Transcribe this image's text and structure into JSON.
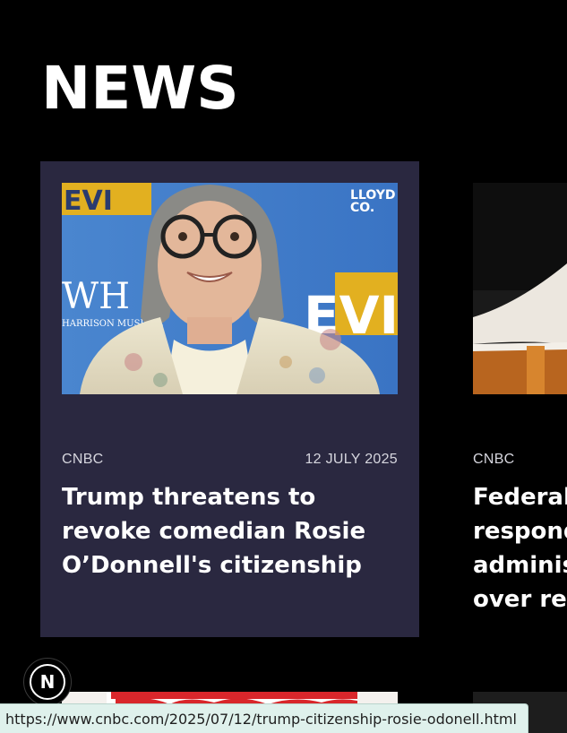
{
  "page": {
    "title": "NEWS"
  },
  "cards": [
    {
      "source": "CNBC",
      "date": "12 JULY 2025",
      "headline": "Trump threatens to revoke comedian Rosie O’Donnell's citizenship"
    },
    {
      "source": "CNBC",
      "headline_lines": [
        "Federal",
        "respond",
        "adminis",
        "over rem"
      ]
    }
  ],
  "framework_badge": {
    "letter": "N",
    "icon": "nextjs-logo-icon"
  },
  "status_bar": {
    "url": "https://www.cnbc.com/2025/07/12/trump-citizenship-rosie-odonell.html"
  },
  "colors": {
    "background": "#000000",
    "card": "#2a2840",
    "text": "#ffffff",
    "meta_text": "#d6d6de",
    "status_bar": "#dff1ec"
  }
}
